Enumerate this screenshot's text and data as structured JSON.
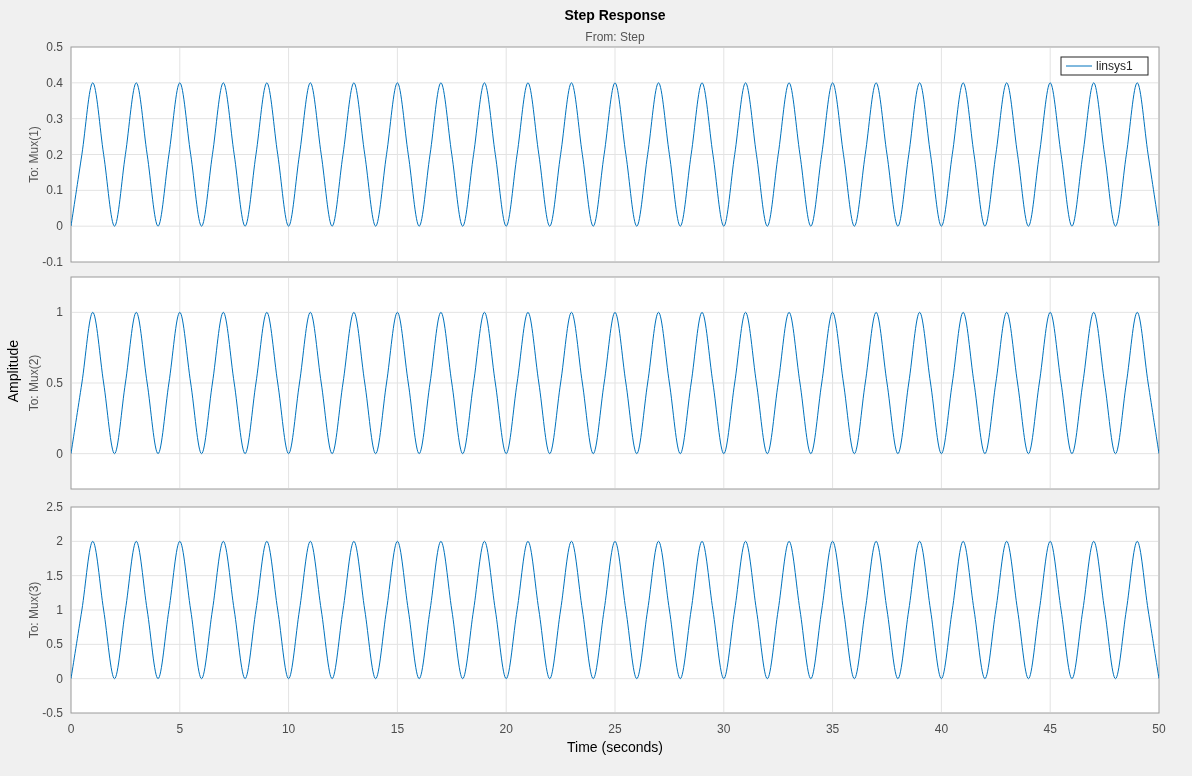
{
  "figure": {
    "title": "Step Response",
    "subtitle": "From: Step",
    "ylabel": "Amplitude",
    "xlabel": "Time (seconds)"
  },
  "axes": [
    {
      "chart_data": {
        "type": "line",
        "grid": true,
        "ylabel": "To: Mux(1)",
        "xlim": [
          0,
          50
        ],
        "ylim": [
          -0.1,
          0.5
        ],
        "yticks": [
          -0.1,
          0,
          0.1,
          0.2,
          0.3,
          0.4,
          0.5
        ],
        "x": [
          0,
          0.5,
          1,
          1.5,
          2,
          2.5,
          3,
          3.5,
          4,
          4.5,
          5,
          5.5,
          6,
          6.5,
          7,
          7.5,
          8,
          8.5,
          9,
          9.5,
          10,
          10.5,
          11,
          11.5,
          12,
          12.5,
          13,
          13.5,
          14,
          14.5,
          15,
          15.5,
          16,
          16.5,
          17,
          17.5,
          18,
          18.5,
          19,
          19.5,
          20,
          20.5,
          21,
          21.5,
          22,
          22.5,
          23,
          23.5,
          24,
          24.5,
          25,
          25.5,
          26,
          26.5,
          27,
          27.5,
          28,
          28.5,
          29,
          29.5,
          30,
          30.5,
          31,
          31.5,
          32,
          32.5,
          33,
          33.5,
          34,
          34.5,
          35,
          35.5,
          36,
          36.5,
          37,
          37.5,
          38,
          38.5,
          39,
          39.5,
          40,
          40.5,
          41,
          41.5,
          42,
          42.5,
          43,
          43.5,
          44,
          44.5,
          45,
          45.5,
          46,
          46.5,
          47,
          47.5,
          48,
          48.5,
          49,
          49.5,
          50
        ],
        "series": [
          {
            "name": "linsys1",
            "color": "#0072bd",
            "values": [
              0,
              0.2,
              0.4,
              0.2,
              0,
              0.2,
              0.4,
              0.2,
              0,
              0.2,
              0.4,
              0.2,
              0,
              0.2,
              0.4,
              0.2,
              0,
              0.2,
              0.4,
              0.2,
              0,
              0.2,
              0.4,
              0.2,
              0,
              0.2,
              0.4,
              0.2,
              0,
              0.2,
              0.4,
              0.2,
              0,
              0.2,
              0.4,
              0.2,
              0,
              0.2,
              0.4,
              0.2,
              0,
              0.2,
              0.4,
              0.2,
              0,
              0.2,
              0.4,
              0.2,
              0,
              0.2,
              0.4,
              0.2,
              0,
              0.2,
              0.4,
              0.2,
              0,
              0.2,
              0.4,
              0.2,
              0,
              0.2,
              0.4,
              0.2,
              0,
              0.2,
              0.4,
              0.2,
              0,
              0.2,
              0.4,
              0.2,
              0,
              0.2,
              0.4,
              0.2,
              0,
              0.2,
              0.4,
              0.2,
              0,
              0.2,
              0.4,
              0.2,
              0,
              0.2,
              0.4,
              0.2,
              0,
              0.2,
              0.4,
              0.2,
              0,
              0.2,
              0.4,
              0.2,
              0,
              0.2,
              0.4,
              0.2,
              0
            ]
          }
        ]
      }
    },
    {
      "chart_data": {
        "type": "line",
        "grid": true,
        "ylabel": "To: Mux(2)",
        "xlim": [
          0,
          50
        ],
        "ylim": [
          -0.25,
          1.25
        ],
        "yticks": [
          0,
          0.5,
          1
        ],
        "x": [
          0,
          0.5,
          1,
          1.5,
          2,
          2.5,
          3,
          3.5,
          4,
          4.5,
          5,
          5.5,
          6,
          6.5,
          7,
          7.5,
          8,
          8.5,
          9,
          9.5,
          10,
          10.5,
          11,
          11.5,
          12,
          12.5,
          13,
          13.5,
          14,
          14.5,
          15,
          15.5,
          16,
          16.5,
          17,
          17.5,
          18,
          18.5,
          19,
          19.5,
          20,
          20.5,
          21,
          21.5,
          22,
          22.5,
          23,
          23.5,
          24,
          24.5,
          25,
          25.5,
          26,
          26.5,
          27,
          27.5,
          28,
          28.5,
          29,
          29.5,
          30,
          30.5,
          31,
          31.5,
          32,
          32.5,
          33,
          33.5,
          34,
          34.5,
          35,
          35.5,
          36,
          36.5,
          37,
          37.5,
          38,
          38.5,
          39,
          39.5,
          40,
          40.5,
          41,
          41.5,
          42,
          42.5,
          43,
          43.5,
          44,
          44.5,
          45,
          45.5,
          46,
          46.5,
          47,
          47.5,
          48,
          48.5,
          49,
          49.5,
          50
        ],
        "series": [
          {
            "color": "#0072bd",
            "values": [
              0,
              0.5,
              1,
              0.5,
              0,
              0.5,
              1,
              0.5,
              0,
              0.5,
              1,
              0.5,
              0,
              0.5,
              1,
              0.5,
              0,
              0.5,
              1,
              0.5,
              0,
              0.5,
              1,
              0.5,
              0,
              0.5,
              1,
              0.5,
              0,
              0.5,
              1,
              0.5,
              0,
              0.5,
              1,
              0.5,
              0,
              0.5,
              1,
              0.5,
              0,
              0.5,
              1,
              0.5,
              0,
              0.5,
              1,
              0.5,
              0,
              0.5,
              1,
              0.5,
              0,
              0.5,
              1,
              0.5,
              0,
              0.5,
              1,
              0.5,
              0,
              0.5,
              1,
              0.5,
              0,
              0.5,
              1,
              0.5,
              0,
              0.5,
              1,
              0.5,
              0,
              0.5,
              1,
              0.5,
              0,
              0.5,
              1,
              0.5,
              0,
              0.5,
              1,
              0.5,
              0,
              0.5,
              1,
              0.5,
              0,
              0.5,
              1,
              0.5,
              0,
              0.5,
              1,
              0.5,
              0,
              0.5,
              1,
              0.5,
              0
            ]
          }
        ]
      }
    },
    {
      "chart_data": {
        "type": "line",
        "grid": true,
        "ylabel": "To: Mux(3)",
        "xlim": [
          0,
          50
        ],
        "ylim": [
          -0.5,
          2.5
        ],
        "xticks": [
          0,
          5,
          10,
          15,
          20,
          25,
          30,
          35,
          40,
          45,
          50
        ],
        "yticks": [
          -0.5,
          0,
          0.5,
          1,
          1.5,
          2,
          2.5
        ],
        "x": [
          0,
          0.5,
          1,
          1.5,
          2,
          2.5,
          3,
          3.5,
          4,
          4.5,
          5,
          5.5,
          6,
          6.5,
          7,
          7.5,
          8,
          8.5,
          9,
          9.5,
          10,
          10.5,
          11,
          11.5,
          12,
          12.5,
          13,
          13.5,
          14,
          14.5,
          15,
          15.5,
          16,
          16.5,
          17,
          17.5,
          18,
          18.5,
          19,
          19.5,
          20,
          20.5,
          21,
          21.5,
          22,
          22.5,
          23,
          23.5,
          24,
          24.5,
          25,
          25.5,
          26,
          26.5,
          27,
          27.5,
          28,
          28.5,
          29,
          29.5,
          30,
          30.5,
          31,
          31.5,
          32,
          32.5,
          33,
          33.5,
          34,
          34.5,
          35,
          35.5,
          36,
          36.5,
          37,
          37.5,
          38,
          38.5,
          39,
          39.5,
          40,
          40.5,
          41,
          41.5,
          42,
          42.5,
          43,
          43.5,
          44,
          44.5,
          45,
          45.5,
          46,
          46.5,
          47,
          47.5,
          48,
          48.5,
          49,
          49.5,
          50
        ],
        "series": [
          {
            "color": "#0072bd",
            "values": [
              0,
              1,
              2,
              1,
              0,
              1,
              2,
              1,
              0,
              1,
              2,
              1,
              0,
              1,
              2,
              1,
              0,
              1,
              2,
              1,
              0,
              1,
              2,
              1,
              0,
              1,
              2,
              1,
              0,
              1,
              2,
              1,
              0,
              1,
              2,
              1,
              0,
              1,
              2,
              1,
              0,
              1,
              2,
              1,
              0,
              1,
              2,
              1,
              0,
              1,
              2,
              1,
              0,
              1,
              2,
              1,
              0,
              1,
              2,
              1,
              0,
              1,
              2,
              1,
              0,
              1,
              2,
              1,
              0,
              1,
              2,
              1,
              0,
              1,
              2,
              1,
              0,
              1,
              2,
              1,
              0,
              1,
              2,
              1,
              0,
              1,
              2,
              1,
              0,
              1,
              2,
              1,
              0,
              1,
              2,
              1,
              0,
              1,
              2,
              1,
              0
            ]
          }
        ]
      }
    }
  ]
}
